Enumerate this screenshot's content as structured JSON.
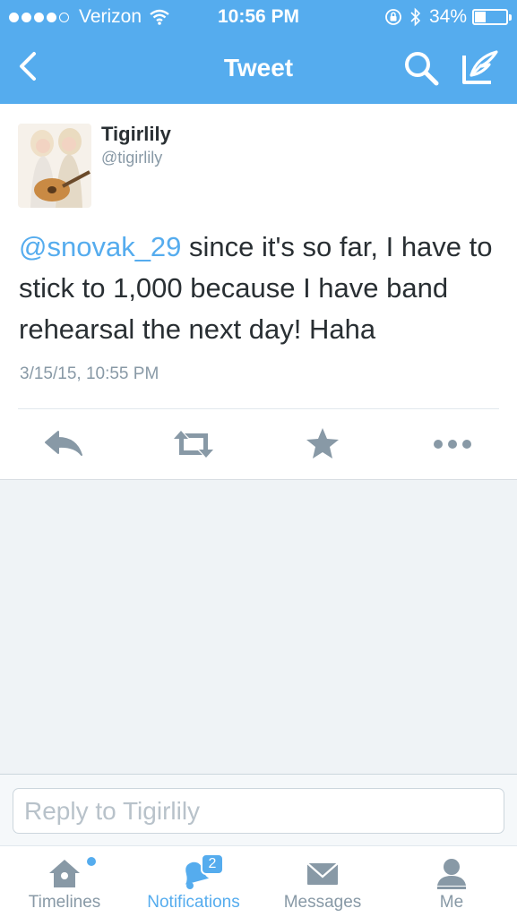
{
  "status_bar": {
    "carrier": "Verizon",
    "time": "10:56 PM",
    "battery_percent": "34%",
    "battery_level": 0.34
  },
  "nav": {
    "title": "Tweet",
    "icons": [
      "back-chevron-icon",
      "search-icon",
      "compose-icon"
    ]
  },
  "tweet": {
    "author_name": "Tigirlily",
    "author_handle": "@tigirlily",
    "mention": "@snovak_29",
    "text": " since it's so far, I have to stick to 1,000 because I have band rehearsal the next day! Haha",
    "timestamp": "3/15/15, 10:55 PM",
    "actions": [
      "reply-icon",
      "retweet-icon",
      "favorite-icon",
      "more-icon"
    ]
  },
  "reply": {
    "placeholder": "Reply to Tigirlily",
    "value": ""
  },
  "tabs": [
    {
      "label": "Timelines",
      "icon": "home-icon",
      "active": false
    },
    {
      "label": "Notifications",
      "icon": "bell-icon",
      "active": true,
      "badge": "2"
    },
    {
      "label": "Messages",
      "icon": "envelope-icon",
      "active": false
    },
    {
      "label": "Me",
      "icon": "person-icon",
      "active": false
    }
  ],
  "colors": {
    "brand": "#55acee",
    "text": "#292f33",
    "muted": "#8899a6",
    "background": "#eff3f6"
  }
}
